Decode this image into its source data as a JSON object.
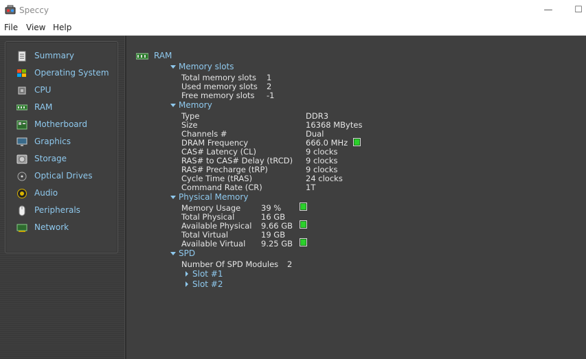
{
  "app": {
    "title": "Speccy"
  },
  "menu": {
    "file": "File",
    "view": "View",
    "help": "Help"
  },
  "sidebar": {
    "items": [
      {
        "label": "Summary"
      },
      {
        "label": "Operating System"
      },
      {
        "label": "CPU"
      },
      {
        "label": "RAM"
      },
      {
        "label": "Motherboard"
      },
      {
        "label": "Graphics"
      },
      {
        "label": "Storage"
      },
      {
        "label": "Optical Drives"
      },
      {
        "label": "Audio"
      },
      {
        "label": "Peripherals"
      },
      {
        "label": "Network"
      }
    ]
  },
  "main": {
    "heading": "RAM",
    "memory_slots": {
      "title": "Memory slots",
      "rows": [
        {
          "label": "Total memory slots",
          "value": "1"
        },
        {
          "label": "Used memory slots",
          "value": "2"
        },
        {
          "label": "Free memory slots",
          "value": "-1"
        }
      ]
    },
    "memory": {
      "title": "Memory",
      "rows": [
        {
          "label": "Type",
          "value": "DDR3"
        },
        {
          "label": "Size",
          "value": "16368 MBytes"
        },
        {
          "label": "Channels #",
          "value": "Dual"
        },
        {
          "label": "DRAM Frequency",
          "value": "666.0 MHz"
        },
        {
          "label": "CAS# Latency (CL)",
          "value": "9 clocks"
        },
        {
          "label": "RAS# to CAS# Delay (tRCD)",
          "value": "9 clocks"
        },
        {
          "label": "RAS# Precharge (tRP)",
          "value": "9 clocks"
        },
        {
          "label": "Cycle Time (tRAS)",
          "value": "24 clocks"
        },
        {
          "label": "Command Rate (CR)",
          "value": "1T"
        }
      ]
    },
    "physical_memory": {
      "title": "Physical Memory",
      "rows": [
        {
          "label": "Memory Usage",
          "value": "39 %"
        },
        {
          "label": "Total Physical",
          "value": "16 GB"
        },
        {
          "label": "Available Physical",
          "value": "9.66 GB"
        },
        {
          "label": "Total Virtual",
          "value": "19 GB"
        },
        {
          "label": "Available Virtual",
          "value": "9.25 GB"
        }
      ]
    },
    "spd": {
      "title": "SPD",
      "modules_label": "Number Of SPD Modules",
      "modules_value": "2",
      "slots": [
        "Slot #1",
        "Slot #2"
      ]
    }
  },
  "colors": {
    "accent_link": "#8fc9ee",
    "meter_green": "#2bd12b",
    "background": "#3f3f3f"
  }
}
